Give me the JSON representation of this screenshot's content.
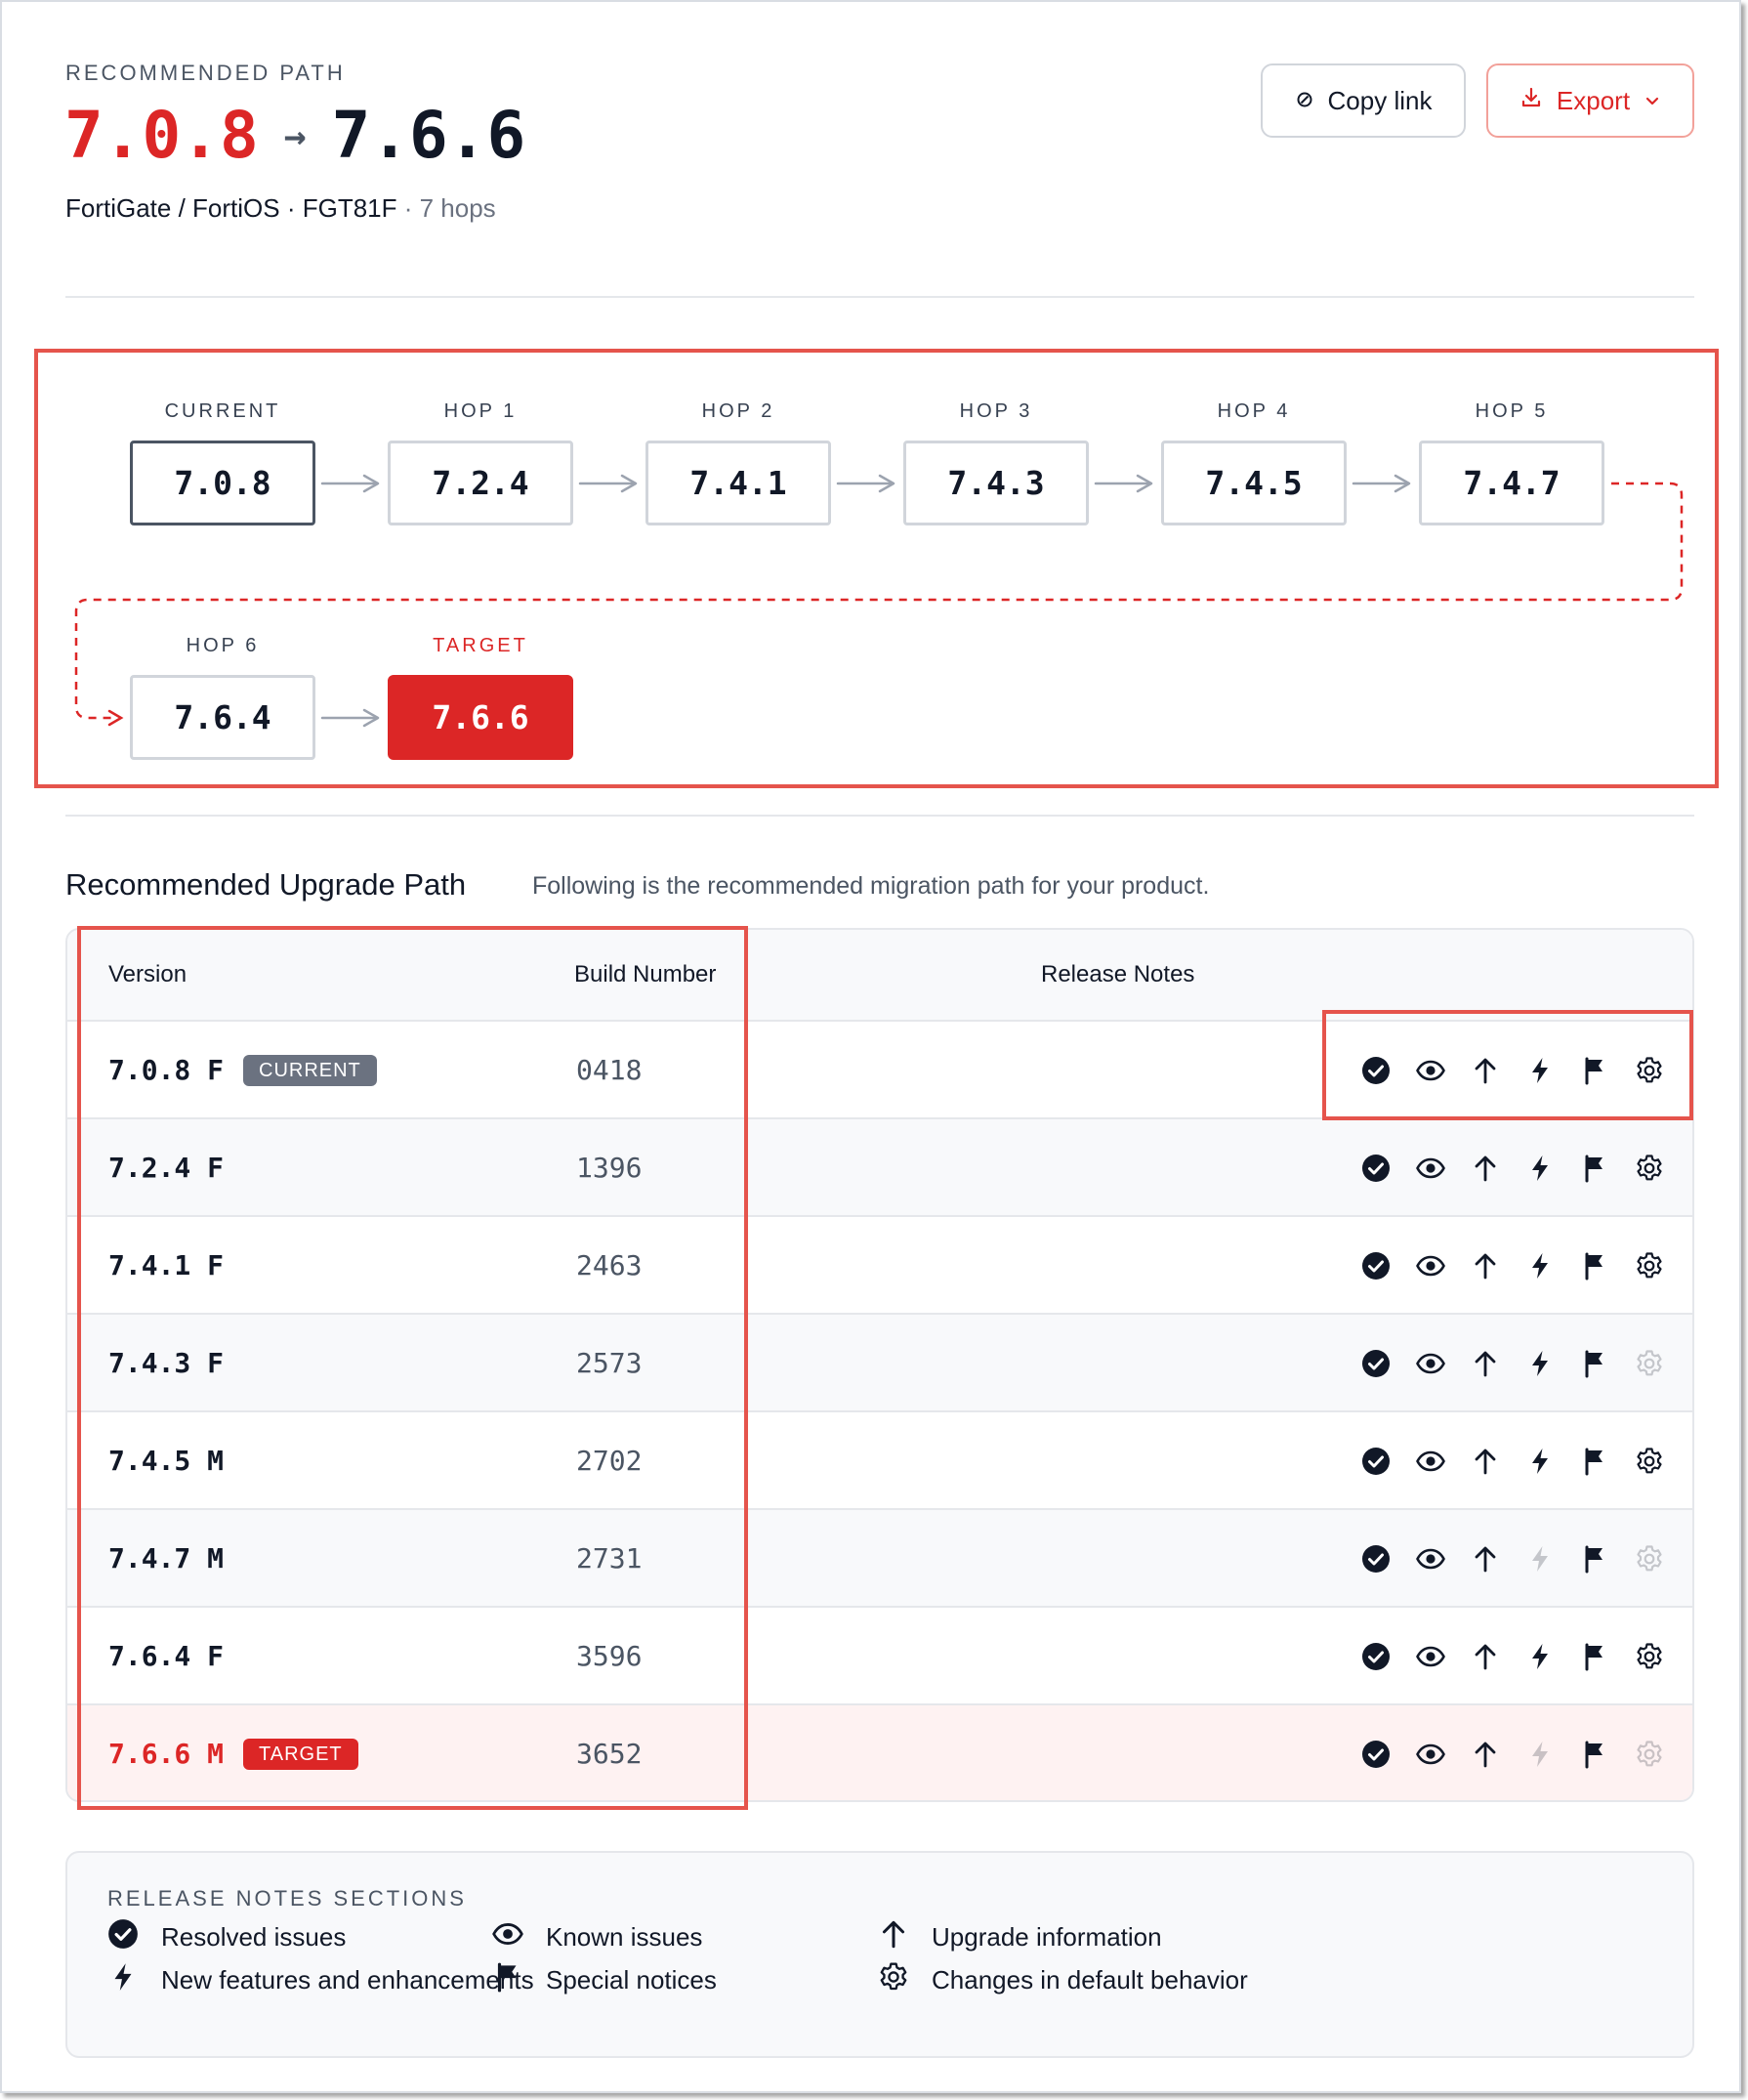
{
  "header": {
    "eyebrow": "RECOMMENDED PATH",
    "from_version": "7.0.8",
    "arrow": "→",
    "to_version": "7.6.6",
    "product": "FortiGate / FortiOS · FGT81F",
    "hops": " · 7 hops",
    "copy_link_label": "Copy link",
    "export_label": "Export"
  },
  "flow": {
    "nodes": [
      {
        "label": "CURRENT",
        "version": "7.0.8"
      },
      {
        "label": "HOP 1",
        "version": "7.2.4"
      },
      {
        "label": "HOP 2",
        "version": "7.4.1"
      },
      {
        "label": "HOP 3",
        "version": "7.4.3"
      },
      {
        "label": "HOP 4",
        "version": "7.4.5"
      },
      {
        "label": "HOP 5",
        "version": "7.4.7"
      },
      {
        "label": "HOP 6",
        "version": "7.6.4"
      },
      {
        "label": "TARGET",
        "version": "7.6.6"
      }
    ]
  },
  "section": {
    "title": "Recommended Upgrade Path",
    "subtitle": "Following is the recommended migration path for your product."
  },
  "table": {
    "columns": [
      "Version",
      "Build Number",
      "Release Notes"
    ],
    "rows": [
      {
        "version": "7.0.8 F",
        "badge": "CURRENT",
        "build": "0418",
        "icons": [
          1,
          1,
          1,
          1,
          1,
          1
        ]
      },
      {
        "version": "7.2.4 F",
        "badge": "",
        "build": "1396",
        "icons": [
          1,
          1,
          1,
          1,
          1,
          1
        ]
      },
      {
        "version": "7.4.1 F",
        "badge": "",
        "build": "2463",
        "icons": [
          1,
          1,
          1,
          1,
          1,
          1
        ]
      },
      {
        "version": "7.4.3 F",
        "badge": "",
        "build": "2573",
        "icons": [
          1,
          1,
          1,
          1,
          1,
          0
        ]
      },
      {
        "version": "7.4.5 M",
        "badge": "",
        "build": "2702",
        "icons": [
          1,
          1,
          1,
          1,
          1,
          1
        ]
      },
      {
        "version": "7.4.7 M",
        "badge": "",
        "build": "2731",
        "icons": [
          1,
          1,
          1,
          0,
          1,
          0
        ]
      },
      {
        "version": "7.6.4 F",
        "badge": "",
        "build": "3596",
        "icons": [
          1,
          1,
          1,
          1,
          1,
          1
        ]
      },
      {
        "version": "7.6.6 M",
        "badge": "TARGET",
        "build": "3652",
        "icons": [
          1,
          1,
          1,
          0,
          1,
          0
        ]
      }
    ],
    "icon_names": [
      "check-circle-icon",
      "eye-icon",
      "arrow-up-icon",
      "bolt-icon",
      "flag-icon",
      "gear-icon"
    ]
  },
  "legend": {
    "title": "RELEASE NOTES SECTIONS",
    "items": [
      {
        "icon": "check-circle-icon",
        "label": "Resolved issues"
      },
      {
        "icon": "eye-icon",
        "label": "Known issues"
      },
      {
        "icon": "arrow-up-icon",
        "label": "Upgrade information"
      },
      {
        "icon": "bolt-icon",
        "label": "New features and enhancements"
      },
      {
        "icon": "flag-icon",
        "label": "Special notices"
      },
      {
        "icon": "gear-icon",
        "label": "Changes in default behavior"
      }
    ]
  },
  "colors": {
    "accent": "#dc2626",
    "highlight": "#e5544c",
    "icon": "#111827",
    "muted": "#6b7280"
  }
}
